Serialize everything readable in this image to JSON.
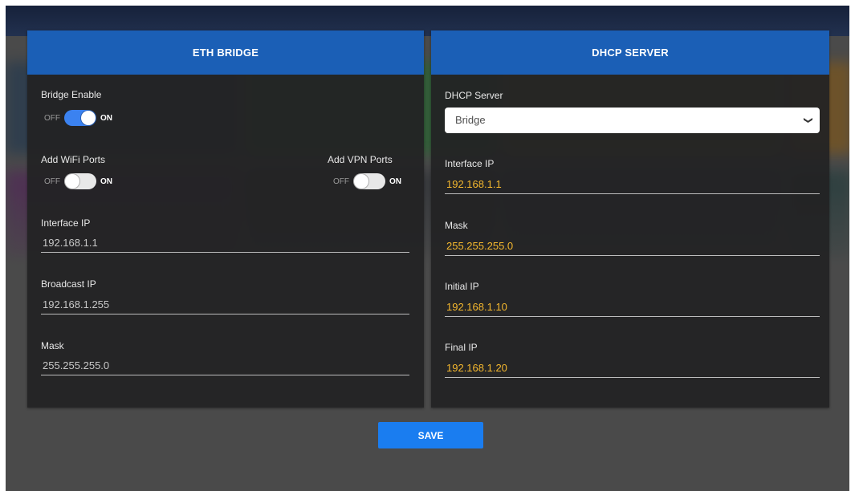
{
  "eth_bridge": {
    "title": "ETH BRIDGE",
    "bridge_enable": {
      "label": "Bridge Enable",
      "off_text": "OFF",
      "on_text": "ON",
      "state": "on"
    },
    "add_wifi_ports": {
      "label": "Add WiFi Ports",
      "off_text": "OFF",
      "on_text": "ON",
      "state": "off"
    },
    "add_vpn_ports": {
      "label": "Add VPN Ports",
      "off_text": "OFF",
      "on_text": "ON",
      "state": "off"
    },
    "interface_ip": {
      "label": "Interface IP",
      "value": "192.168.1.1"
    },
    "broadcast_ip": {
      "label": "Broadcast IP",
      "value": "192.168.1.255"
    },
    "mask": {
      "label": "Mask",
      "value": "255.255.255.0"
    }
  },
  "dhcp_server": {
    "title": "DHCP SERVER",
    "mode": {
      "label": "DHCP Server",
      "selected": "Bridge"
    },
    "interface_ip": {
      "label": "Interface IP",
      "value": "192.168.1.1"
    },
    "mask": {
      "label": "Mask",
      "value": "255.255.255.0"
    },
    "initial_ip": {
      "label": "Initial IP",
      "value": "192.168.1.10"
    },
    "final_ip": {
      "label": "Final IP",
      "value": "192.168.1.20"
    }
  },
  "actions": {
    "save_label": "SAVE"
  },
  "colors": {
    "header_blue": "#1b5fb6",
    "toggle_on": "#3b82f0",
    "value_amber": "#f5b82e",
    "save_button": "#1a7df0",
    "panel_bg": "#222224"
  },
  "icons": {
    "select_arrow": "chevron-down-icon"
  }
}
